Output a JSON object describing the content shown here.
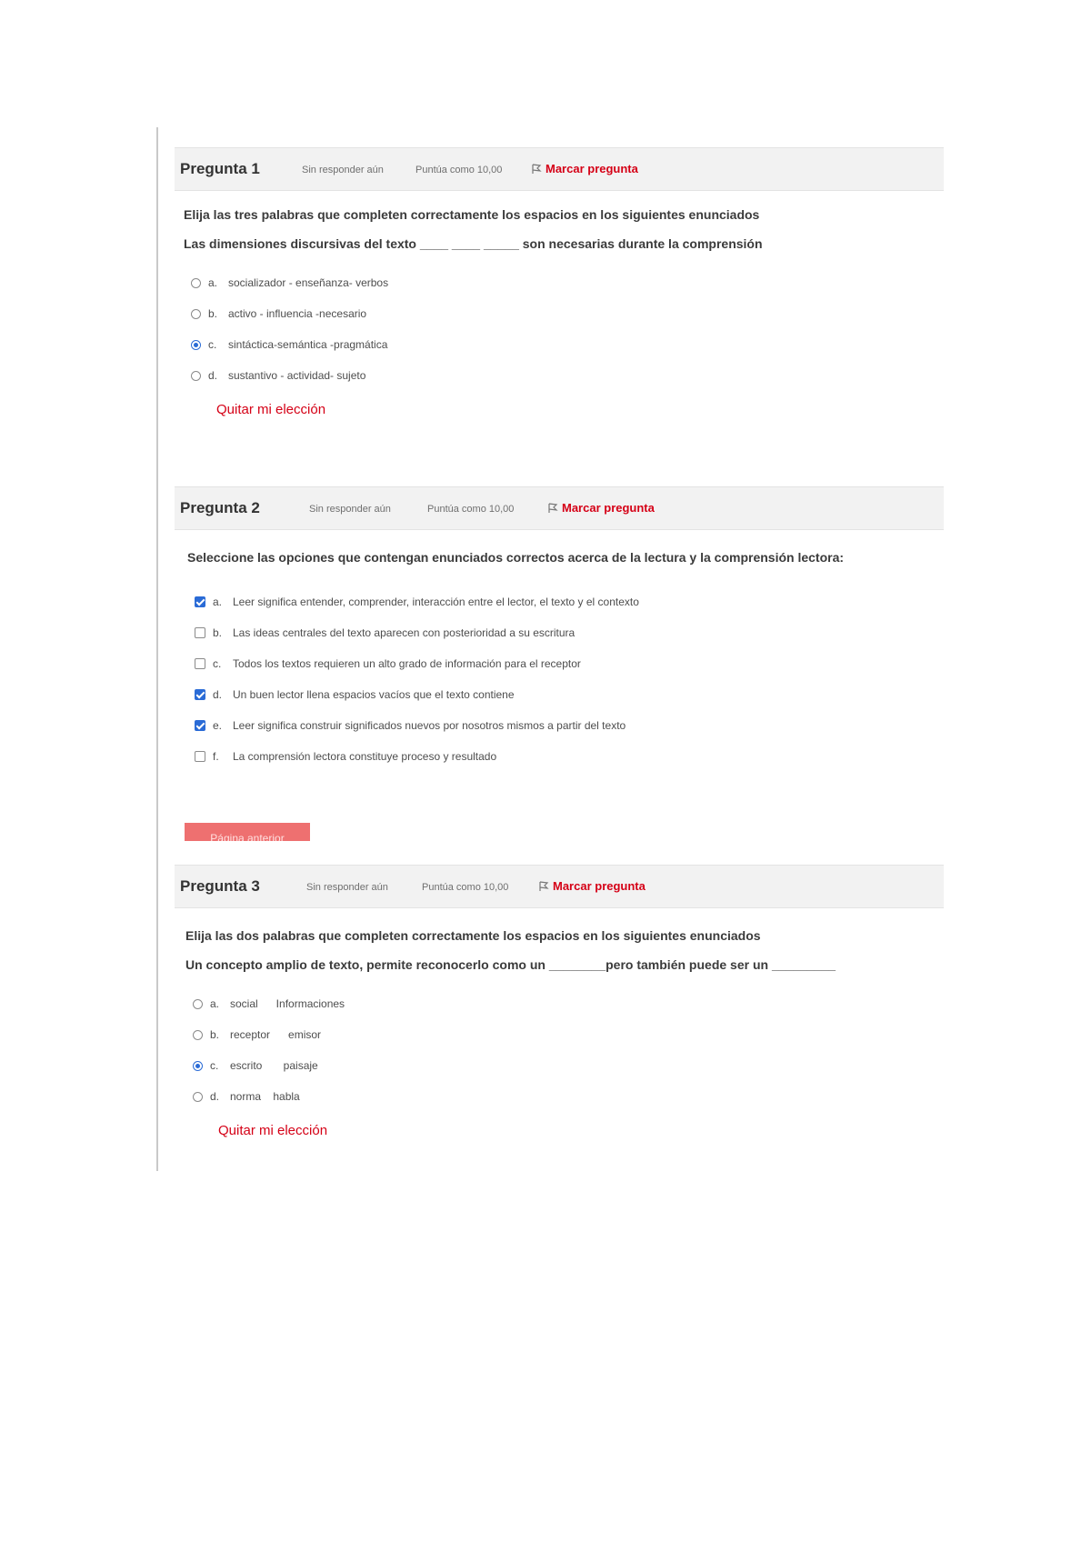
{
  "q1": {
    "title": "Pregunta 1",
    "status": "Sin responder aún",
    "score": "Puntúa como 10,00",
    "flag": "Marcar pregunta",
    "prompt1": "Elija las tres palabras que completen correctamente los espacios en los siguientes enunciados",
    "prompt2": "Las dimensiones discursivas del texto ____ ____  _____ son necesarias durante la comprensión",
    "answers": [
      {
        "letter": "a.",
        "text": "socializador - enseñanza- verbos",
        "selected": false
      },
      {
        "letter": "b.",
        "text": "activo - influencia -necesario",
        "selected": false
      },
      {
        "letter": "c.",
        "text": "sintáctica-semántica -pragmática",
        "selected": true
      },
      {
        "letter": "d.",
        "text": "sustantivo - actividad- sujeto",
        "selected": false
      }
    ],
    "clear": "Quitar mi elección"
  },
  "q2": {
    "title": "Pregunta 2",
    "status": "Sin responder aún",
    "score": "Puntúa como 10,00",
    "flag": "Marcar pregunta",
    "prompt1": "Seleccione las opciones que contengan enunciados correctos acerca de la lectura y la comprensión lectora:",
    "answers": [
      {
        "letter": "a.",
        "text": "Leer significa entender, comprender, interacción entre el lector, el texto y el contexto",
        "checked": true
      },
      {
        "letter": "b.",
        "text": "Las ideas centrales del texto aparecen  con posterioridad  a  su escritura",
        "checked": false
      },
      {
        "letter": "c.",
        "text": "Todos los textos requieren un alto grado de información para el receptor",
        "checked": false
      },
      {
        "letter": "d.",
        "text": "Un buen lector llena espacios vacíos que el texto contiene",
        "checked": true
      },
      {
        "letter": "e.",
        "text": "Leer significa construir significados nuevos por nosotros mismos a partir del texto",
        "checked": true
      },
      {
        "letter": "f.",
        "text": "La comprensión lectora constituye proceso y resultado",
        "checked": false
      }
    ],
    "prev_button": "Página anterior"
  },
  "q3": {
    "title": "Pregunta 3",
    "status": "Sin responder aún",
    "score": "Puntúa como 10,00",
    "flag": "Marcar pregunta",
    "prompt1": "Elija las dos palabras que completen correctamente los espacios en los siguientes enunciados",
    "prompt2": "Un concepto amplio de texto, permite reconocerlo como un ________pero también puede ser un   _________",
    "answers": [
      {
        "letter": "a.",
        "text": "social      Informaciones",
        "selected": false
      },
      {
        "letter": "b.",
        "text": "receptor      emisor",
        "selected": false
      },
      {
        "letter": "c.",
        "text": "escrito       paisaje",
        "selected": true
      },
      {
        "letter": "d.",
        "text": "norma    habla",
        "selected": false
      }
    ],
    "clear": "Quitar mi elección"
  },
  "colors": {
    "accent_red": "#d50016",
    "selected_blue": "#2a6bd6",
    "header_bg": "#f2f2f2"
  }
}
